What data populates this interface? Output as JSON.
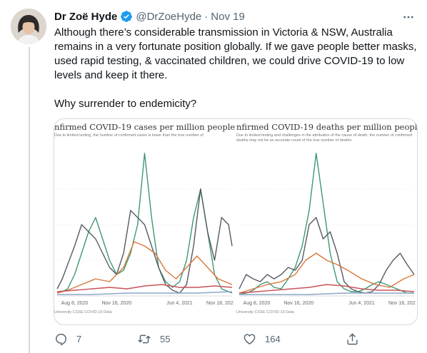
{
  "tweet": {
    "author_name": "Dr Zoë Hyde",
    "handle": "@DrZoeHyde",
    "separator": "·",
    "time": "Nov 19",
    "text_p1": "Although there’s considerable transmission in Victoria & NSW, Australia remains in a very fortunate position globally. If we gave people better masks, used rapid testing, & vaccinated children, we could drive COVID-19 to low levels and keep it there.",
    "text_p2": "Why surrender to endemicity?",
    "icons": {
      "verified": "verified-badge-icon",
      "more": "more-options-icon",
      "reply": "reply-icon",
      "retweet": "retweet-icon",
      "like": "like-icon",
      "share": "share-icon"
    }
  },
  "actions": {
    "replies": "7",
    "retweets": "55",
    "likes": "164"
  },
  "colors": {
    "text": "#0f1419",
    "muted": "#536471",
    "verified": "#1d9bf0",
    "border": "#cfd9de"
  },
  "chart_data": [
    {
      "type": "line",
      "title": "nfirmed COVID-19 cases per million people",
      "subtitle": "Due to limited testing, the number of confirmed cases is lower than the true number of",
      "x_ticks": [
        "Aug 8, 2020",
        "Nov 16, 2020",
        "Jun 4, 2021",
        "Nov 18, 202"
      ],
      "source": "University CSSE COVID-19 Data",
      "series": [
        {
          "color": "#3d9970",
          "x": [
            0,
            0.03,
            0.06,
            0.1,
            0.14,
            0.18,
            0.22,
            0.26,
            0.3,
            0.34,
            0.38,
            0.42,
            0.46,
            0.5,
            0.54,
            0.58,
            0.62,
            0.66,
            0.7,
            0.74,
            0.78,
            0.82,
            0.86,
            0.9,
            0.94,
            0.98,
            1
          ],
          "y": [
            0.02,
            0.03,
            0.05,
            0.15,
            0.3,
            0.45,
            0.55,
            0.4,
            0.25,
            0.15,
            0.18,
            0.3,
            0.5,
            1.0,
            0.55,
            0.2,
            0.1,
            0.06,
            0.1,
            0.25,
            0.55,
            0.75,
            0.45,
            0.15,
            0.05,
            0.03,
            0.02
          ]
        },
        {
          "color": "#555a66",
          "x": [
            0,
            0.03,
            0.06,
            0.1,
            0.14,
            0.18,
            0.22,
            0.26,
            0.3,
            0.34,
            0.38,
            0.42,
            0.46,
            0.5,
            0.54,
            0.58,
            0.62,
            0.66,
            0.7,
            0.74,
            0.78,
            0.82,
            0.86,
            0.9,
            0.94,
            0.98,
            1
          ],
          "y": [
            0.05,
            0.12,
            0.22,
            0.35,
            0.5,
            0.45,
            0.4,
            0.3,
            0.2,
            0.15,
            0.3,
            0.6,
            0.55,
            0.5,
            0.35,
            0.2,
            0.08,
            0.04,
            0.02,
            0.08,
            0.35,
            0.75,
            0.45,
            0.25,
            0.55,
            0.5,
            0.35
          ]
        },
        {
          "color": "#d9773b",
          "x": [
            0,
            0.06,
            0.14,
            0.22,
            0.3,
            0.38,
            0.44,
            0.5,
            0.56,
            0.62,
            0.68,
            0.74,
            0.8,
            0.86,
            0.92,
            1
          ],
          "y": [
            0.02,
            0.04,
            0.08,
            0.12,
            0.1,
            0.2,
            0.38,
            0.35,
            0.3,
            0.18,
            0.12,
            0.2,
            0.28,
            0.2,
            0.12,
            0.08
          ]
        },
        {
          "color": "#c8525a",
          "x": [
            0,
            0.1,
            0.2,
            0.3,
            0.4,
            0.5,
            0.6,
            0.7,
            0.8,
            0.9,
            1
          ],
          "y": [
            0.03,
            0.04,
            0.05,
            0.06,
            0.05,
            0.07,
            0.08,
            0.06,
            0.06,
            0.07,
            0.06
          ]
        },
        {
          "color": "#8aa9c9",
          "x": [
            0,
            0.2,
            0.4,
            0.6,
            0.8,
            1
          ],
          "y": [
            0.01,
            0.01,
            0.02,
            0.02,
            0.02,
            0.03
          ]
        }
      ]
    },
    {
      "type": "line",
      "title": "nfirmed COVID-19 deaths per million people",
      "subtitle": "Due to limited testing and challenges in the attribution of the cause of death, the number of confirmed deaths may not be an accurate count of the true number of deaths.",
      "x_ticks": [
        "Aug 8, 2020",
        "Nov 16, 2020",
        "Jun 4, 2021",
        "Nov 18, 202"
      ],
      "source": "University CSSE COVID-19 Data",
      "series": [
        {
          "color": "#3d9970",
          "x": [
            0,
            0.04,
            0.08,
            0.12,
            0.16,
            0.2,
            0.24,
            0.28,
            0.32,
            0.36,
            0.4,
            0.44,
            0.48,
            0.52,
            0.56,
            0.6,
            0.64,
            0.68,
            0.72,
            0.76,
            0.8,
            0.84,
            0.88,
            0.92,
            0.96,
            1
          ],
          "y": [
            0.01,
            0.02,
            0.04,
            0.08,
            0.1,
            0.06,
            0.05,
            0.12,
            0.2,
            0.35,
            0.6,
            1.0,
            0.65,
            0.3,
            0.1,
            0.05,
            0.03,
            0.03,
            0.05,
            0.08,
            0.1,
            0.08,
            0.06,
            0.04,
            0.02,
            0.02
          ]
        },
        {
          "color": "#555a66",
          "x": [
            0,
            0.04,
            0.08,
            0.12,
            0.16,
            0.2,
            0.24,
            0.28,
            0.32,
            0.36,
            0.4,
            0.44,
            0.48,
            0.52,
            0.56,
            0.6,
            0.64,
            0.68,
            0.72,
            0.76,
            0.8,
            0.84,
            0.88,
            0.92,
            0.96,
            1
          ],
          "y": [
            0.05,
            0.15,
            0.12,
            0.1,
            0.15,
            0.12,
            0.15,
            0.2,
            0.18,
            0.25,
            0.5,
            0.55,
            0.4,
            0.45,
            0.3,
            0.1,
            0.05,
            0.03,
            0.02,
            0.03,
            0.08,
            0.18,
            0.25,
            0.3,
            0.22,
            0.15
          ]
        },
        {
          "color": "#d9773b",
          "x": [
            0,
            0.08,
            0.16,
            0.24,
            0.32,
            0.38,
            0.44,
            0.5,
            0.56,
            0.62,
            0.7,
            0.78,
            0.86,
            0.94,
            1
          ],
          "y": [
            0.02,
            0.05,
            0.08,
            0.1,
            0.15,
            0.25,
            0.3,
            0.25,
            0.22,
            0.18,
            0.12,
            0.08,
            0.06,
            0.12,
            0.15
          ]
        },
        {
          "color": "#c8525a",
          "x": [
            0,
            0.1,
            0.2,
            0.3,
            0.4,
            0.5,
            0.6,
            0.7,
            0.8,
            0.9,
            1
          ],
          "y": [
            0.02,
            0.03,
            0.04,
            0.05,
            0.06,
            0.08,
            0.07,
            0.05,
            0.04,
            0.04,
            0.03
          ]
        },
        {
          "color": "#8aa9c9",
          "x": [
            0,
            0.2,
            0.4,
            0.6,
            0.8,
            1
          ],
          "y": [
            0.01,
            0.01,
            0.01,
            0.02,
            0.02,
            0.02
          ]
        }
      ]
    }
  ]
}
